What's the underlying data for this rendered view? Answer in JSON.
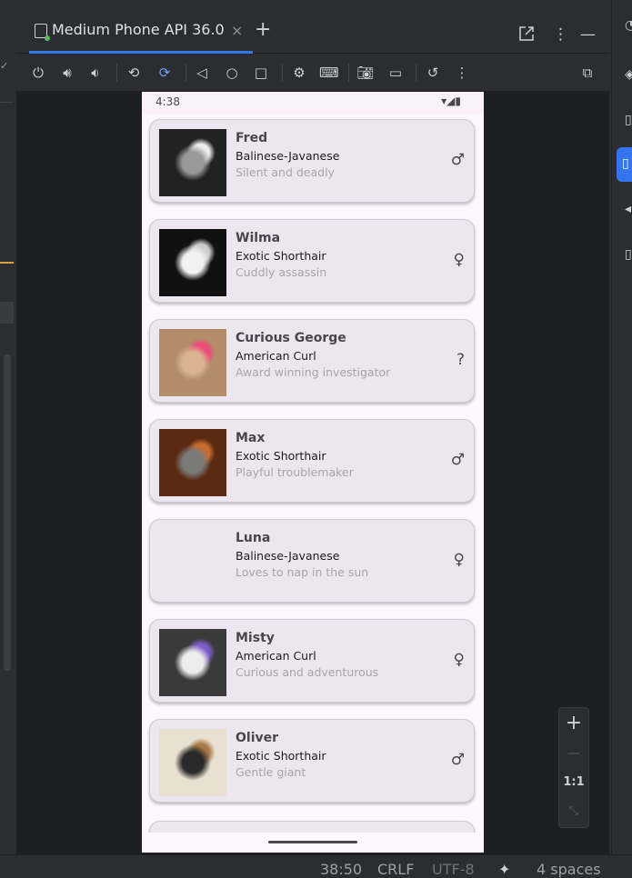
{
  "tab": {
    "label": "Medium Phone API 36.0",
    "close": "×",
    "add": "+"
  },
  "window": {
    "detach_icon": "external-window-icon",
    "more": "⋮",
    "minimize": "—"
  },
  "toolbar": {
    "items": [
      {
        "name": "power-icon",
        "glyph": "⏻"
      },
      {
        "name": "volume-up-icon",
        "glyph": "🔊︎"
      },
      {
        "name": "volume-down-icon",
        "glyph": "🔉︎"
      },
      {
        "name": "rotate-left-icon",
        "glyph": "⟲"
      },
      {
        "name": "rotate-right-icon",
        "glyph": "⟳"
      },
      {
        "name": "back-icon",
        "glyph": "◁"
      },
      {
        "name": "home-icon",
        "glyph": "○"
      },
      {
        "name": "overview-icon",
        "glyph": "□"
      },
      {
        "name": "device-settings-icon",
        "glyph": "⚙"
      },
      {
        "name": "keyboard-icon",
        "glyph": "⌨"
      },
      {
        "name": "camera-icon",
        "glyph": "📷︎"
      },
      {
        "name": "record-icon",
        "glyph": "▭"
      },
      {
        "name": "reset-icon",
        "glyph": "↺"
      },
      {
        "name": "more-icon",
        "glyph": "⋮"
      },
      {
        "name": "device-explorer-icon",
        "glyph": "⧉"
      }
    ]
  },
  "phone": {
    "time": "4:38",
    "status_icons": "▾◢▮",
    "cats": [
      {
        "name": "Fred",
        "breed": "Balinese-Javanese",
        "description": "Silent and deadly",
        "gender": "♂",
        "colors": [
          "#222",
          "#999",
          "#eee"
        ]
      },
      {
        "name": "Wilma",
        "breed": "Exotic Shorthair",
        "description": "Cuddly assassin",
        "gender": "♀",
        "colors": [
          "#111",
          "#f2f2f2",
          "#cccccc"
        ]
      },
      {
        "name": "Curious George",
        "breed": "American Curl",
        "description": "Award winning investigator",
        "gender": "?",
        "colors": [
          "#b38d6a",
          "#d9b48f",
          "#f04a7a"
        ]
      },
      {
        "name": "Max",
        "breed": "Exotic Shorthair",
        "description": "Playful troublemaker",
        "gender": "♂",
        "colors": [
          "#5a2a12",
          "#7a7a78",
          "#c96c2e"
        ]
      },
      {
        "name": "Luna",
        "breed": "Balinese-Javanese",
        "description": "Loves to nap in the sun",
        "gender": "♀",
        "colors": [
          "#ece6f0",
          "#ece6f0",
          "#ece6f0"
        ]
      },
      {
        "name": "Misty",
        "breed": "American Curl",
        "description": "Curious and adventurous",
        "gender": "♀",
        "colors": [
          "#3a3a3a",
          "#ededed",
          "#7b5fc9"
        ]
      },
      {
        "name": "Oliver",
        "breed": "Exotic Shorthair",
        "description": "Gentle giant",
        "gender": "♂",
        "colors": [
          "#e8e0d0",
          "#2a2a2a",
          "#a87a4a"
        ]
      }
    ]
  },
  "zoom": {
    "plus": "+",
    "minus": "—",
    "ratio": "1:1",
    "fit": "⤡"
  },
  "statusbar": {
    "position": "38:50",
    "line_sep": "CRLF",
    "encoding": "UTF-8",
    "ai": "✦",
    "indent": "4 spaces"
  }
}
